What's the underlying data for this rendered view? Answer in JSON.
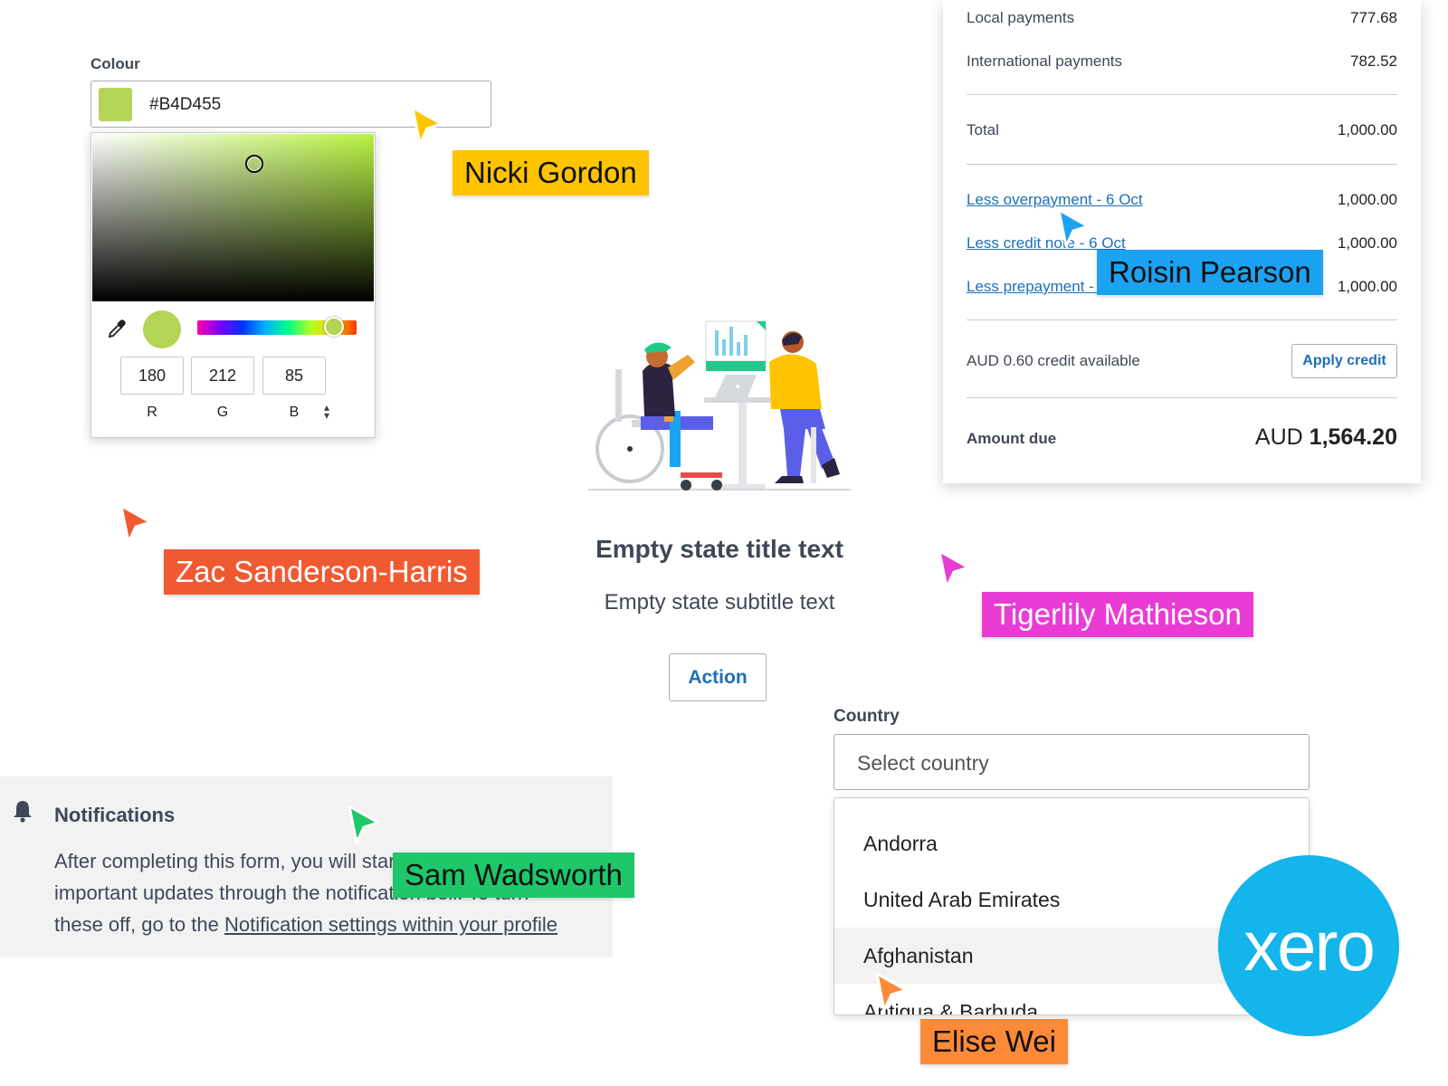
{
  "colour_picker": {
    "label": "Colour",
    "hex": "#B4D455",
    "swatch_color": "#B4D455",
    "rgb_values": [
      "180",
      "212",
      "85"
    ],
    "channel_labels": [
      "R",
      "G",
      "B"
    ],
    "mode_toggle_icon": "updown-arrows-icon",
    "eyedropper_icon": "eyedropper-icon"
  },
  "collaborators": [
    {
      "name": "Nicki Gordon",
      "color": "#FFC400"
    },
    {
      "name": "Roisin Pearson",
      "color": "#1BA2F2"
    },
    {
      "name": "Zac Sanderson-Harris",
      "color": "#F05A32"
    },
    {
      "name": "Tigerlily Mathieson",
      "color": "#E93CD4"
    },
    {
      "name": "Sam Wadsworth",
      "color": "#1DC76A"
    },
    {
      "name": "Elise Wei",
      "color": "#FC8A38"
    }
  ],
  "invoice": {
    "rows": [
      {
        "label": "Local payments",
        "amount": "777.68"
      },
      {
        "label": "International payments",
        "amount": "782.52"
      },
      {
        "label": "Total",
        "amount": "1,000.00"
      }
    ],
    "links": [
      {
        "label": "Less overpayment - 6 Oct",
        "amount": "1,000.00"
      },
      {
        "label": "Less credit note - 6 Oct",
        "amount": "1,000.00"
      },
      {
        "label": "Less prepayment - 6 Oct",
        "amount": "1,000.00"
      }
    ],
    "credit_text": "AUD 0.60 credit available",
    "apply_label": "Apply credit",
    "due_label": "Amount due",
    "due_currency": "AUD",
    "due_amount": "1,564.20"
  },
  "empty_state": {
    "title": "Empty state title text",
    "subtitle": "Empty state subtitle text",
    "action_label": "Action",
    "illustration": "people-working-illustration"
  },
  "notifications": {
    "title": "Notifications",
    "bell_icon": "bell-icon",
    "line1": "After completing this form, you will start receiving",
    "line2": "important updates through the notification bell. To turn",
    "line3_prefix": "these off, go to the ",
    "link": "Notification settings within your profile"
  },
  "country": {
    "label": "Country",
    "placeholder": "Select country",
    "options": [
      "Andorra",
      "United Arab Emirates",
      "Afghanistan",
      "Antigua & Barbuda"
    ],
    "highlighted": "Afghanistan"
  },
  "brand": {
    "logo_text": "xero",
    "color": "#13B5EA"
  }
}
